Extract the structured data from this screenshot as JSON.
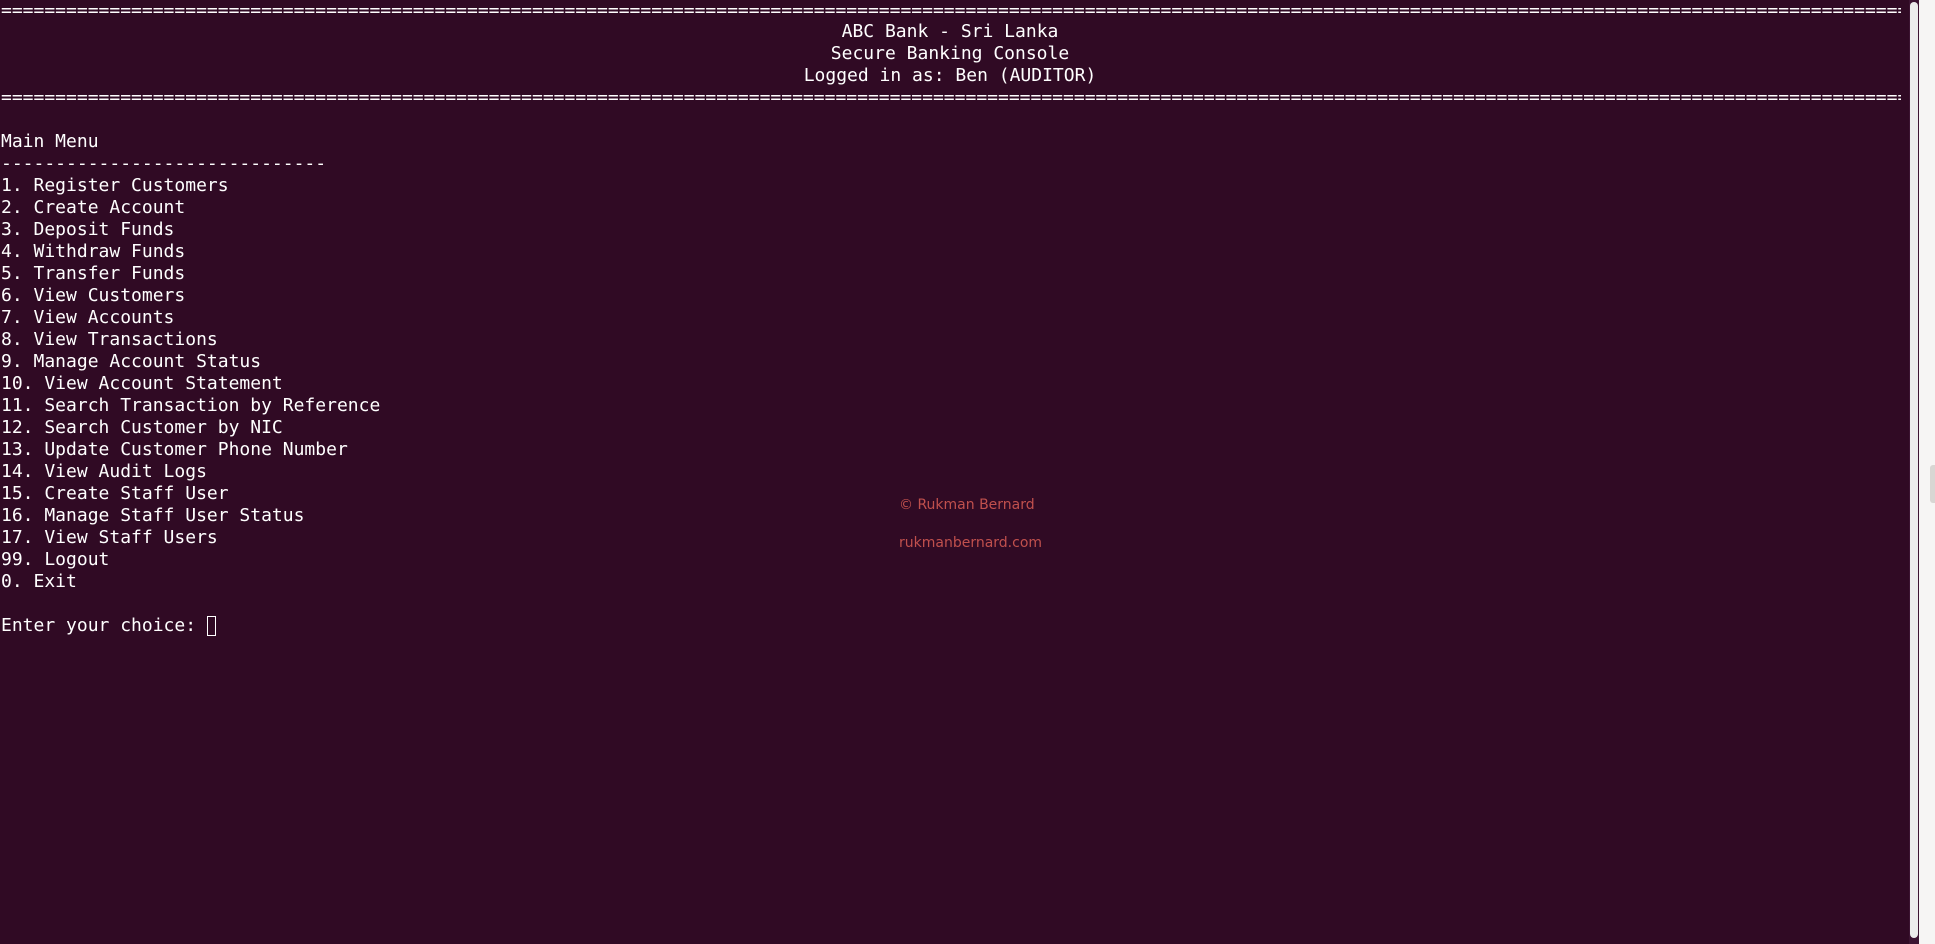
{
  "header": {
    "rule": "=================================================================================================================================================================================================",
    "bank_name": "ABC Bank - Sri Lanka",
    "console_title": "Secure Banking Console",
    "logged_in": "Logged in as: Ben (AUDITOR)"
  },
  "menu": {
    "title": "Main Menu",
    "divider": "------------------------------",
    "items": [
      "1. Register Customers",
      "2. Create Account",
      "3. Deposit Funds",
      "4. Withdraw Funds",
      "5. Transfer Funds",
      "6. View Customers",
      "7. View Accounts",
      "8. View Transactions",
      "9. Manage Account Status",
      "10. View Account Statement",
      "11. Search Transaction by Reference",
      "12. Search Customer by NIC",
      "13. Update Customer Phone Number",
      "14. View Audit Logs",
      "15. Create Staff User",
      "16. Manage Staff User Status",
      "17. View Staff Users",
      "99. Logout",
      "0. Exit"
    ]
  },
  "prompt": {
    "label": "Enter your choice: "
  },
  "watermark": {
    "copyright": "© Rukman Bernard",
    "website": "rukmanbernard.com"
  },
  "colors": {
    "background": "#300a24",
    "text": "#ffffff",
    "watermark": "#c0504d"
  }
}
